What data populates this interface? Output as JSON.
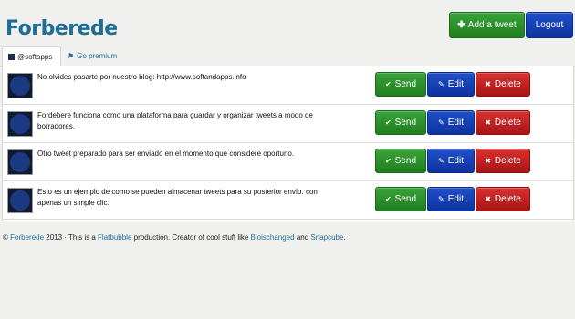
{
  "header": {
    "logo_text": "Forberede",
    "add_tweet_label": "Add a tweet",
    "add_tweet_icon": "plus-icon",
    "logout_label": "Logout"
  },
  "tabs": [
    {
      "label": "@softapps",
      "icon": "account-avatar-icon",
      "active": true
    },
    {
      "label": "Go premium",
      "icon": "tag-icon",
      "active": false
    }
  ],
  "tweets": [
    {
      "text": "No olvides pasarte por nuestro blog: http://www.softandapps.info"
    },
    {
      "text": "Fordebere funciona como una plataforma para guardar y organizar tweets a modo de borradores."
    },
    {
      "text": "Otro tweet preparado para ser enviado en el momento que considere oportuno."
    },
    {
      "text": "Esto es un ejemplo de como se pueden almacenar tweets para su posterior envío. con apenas un simple clic."
    }
  ],
  "actions": {
    "send_label": "Send",
    "edit_label": "Edit",
    "delete_label": "Delete"
  },
  "footer": {
    "prefix": "© ",
    "brand_link": "Forberede",
    "text1": " 2013 · This is a ",
    "flatbubble_link": "Flatbubble",
    "text2": " production. Creator of cool stuff like ",
    "bioischanged_link": "Bioischanged",
    "text3": " and ",
    "snapcube_link": "Snapcube",
    "suffix": "."
  },
  "colors": {
    "brand": "#1f6d95",
    "send_green": "#2a8f2a",
    "edit_blue": "#1440b8",
    "delete_red": "#c02020"
  }
}
